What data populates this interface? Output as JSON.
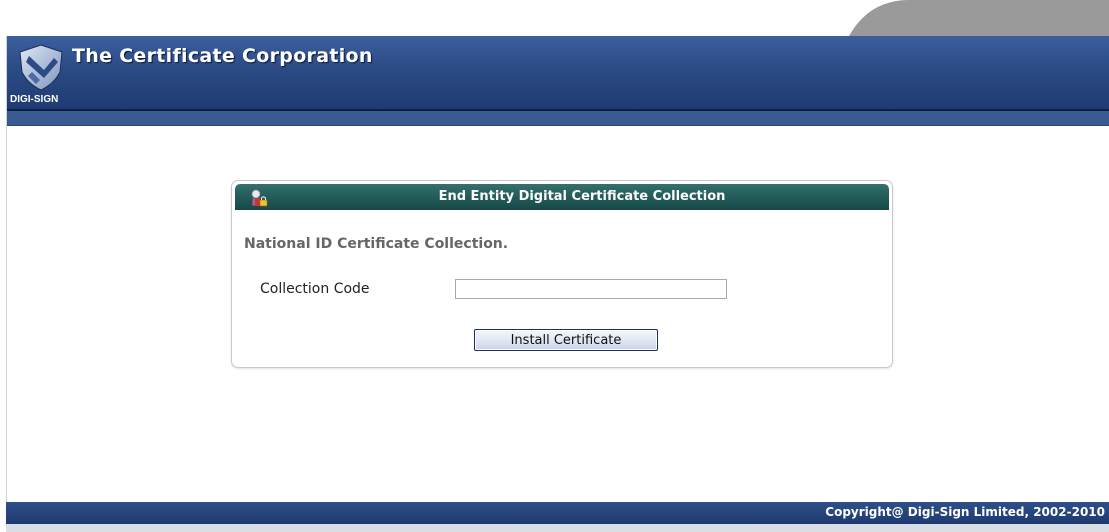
{
  "header": {
    "company_name": "The Certificate Corporation",
    "brand_label": "DIGI-SIGN",
    "logo_icon": "digi-sign-shield-logo"
  },
  "panel": {
    "title": "End Entity Digital Certificate Collection",
    "title_icon": "certificate-lock-icon",
    "heading": "National ID Certificate Collection.",
    "collection_code_label": "Collection Code",
    "collection_code_value": "",
    "collection_code_placeholder": "",
    "install_button_label": "Install Certificate"
  },
  "footer": {
    "copyright": "Copyright@ Digi-Sign Limited, 2002-2010"
  },
  "colors": {
    "header_blue": "#2b4b86",
    "panel_title_teal": "#215a58",
    "footer_blue": "#1d3a70"
  }
}
